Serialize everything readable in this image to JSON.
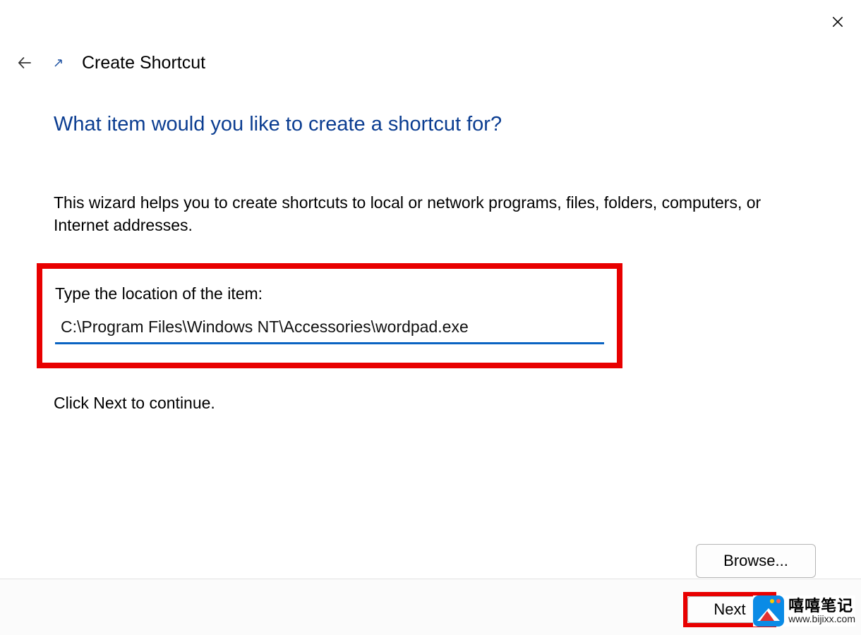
{
  "header": {
    "title": "Create Shortcut"
  },
  "content": {
    "heading": "What item would you like to create a shortcut for?",
    "description": "This wizard helps you to create shortcuts to local or network programs, files, folders, computers, or Internet addresses.",
    "input_label": "Type the location of the item:",
    "input_value": "C:\\Program Files\\Windows NT\\Accessories\\wordpad.exe",
    "browse_label": "Browse...",
    "continue_text": "Click Next to continue."
  },
  "footer": {
    "next_label": "Next"
  },
  "watermark": {
    "title": "嘻嘻笔记",
    "url": "www.bijixx.com"
  },
  "colors": {
    "heading_blue": "#0b3d91",
    "accent_blue": "#0a63c2",
    "highlight_red": "#e80000"
  }
}
